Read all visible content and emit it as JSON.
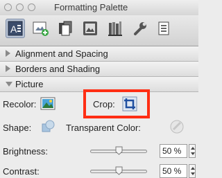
{
  "window": {
    "title": "Formatting Palette"
  },
  "toolbar": {
    "buttons": [
      {
        "icon": "text-style-icon"
      },
      {
        "icon": "add-object-icon"
      },
      {
        "icon": "document-pages-icon"
      },
      {
        "icon": "image-frame-icon"
      },
      {
        "icon": "library-icon"
      },
      {
        "icon": "wrench-icon"
      },
      {
        "icon": "documents-icon"
      }
    ]
  },
  "sections": {
    "alignment": "Alignment and Spacing",
    "borders": "Borders and Shading",
    "picture": "Picture"
  },
  "picture": {
    "recolor_label": "Recolor:",
    "crop_label": "Crop:",
    "shape_label": "Shape:",
    "transparent_label": "Transparent Color:",
    "brightness_label": "Brightness:",
    "brightness_value": "50 %",
    "contrast_label": "Contrast:",
    "contrast_value": "50 %"
  },
  "colors": {
    "highlight": "#ff2e14",
    "active_tab": "#b9c4d6"
  }
}
